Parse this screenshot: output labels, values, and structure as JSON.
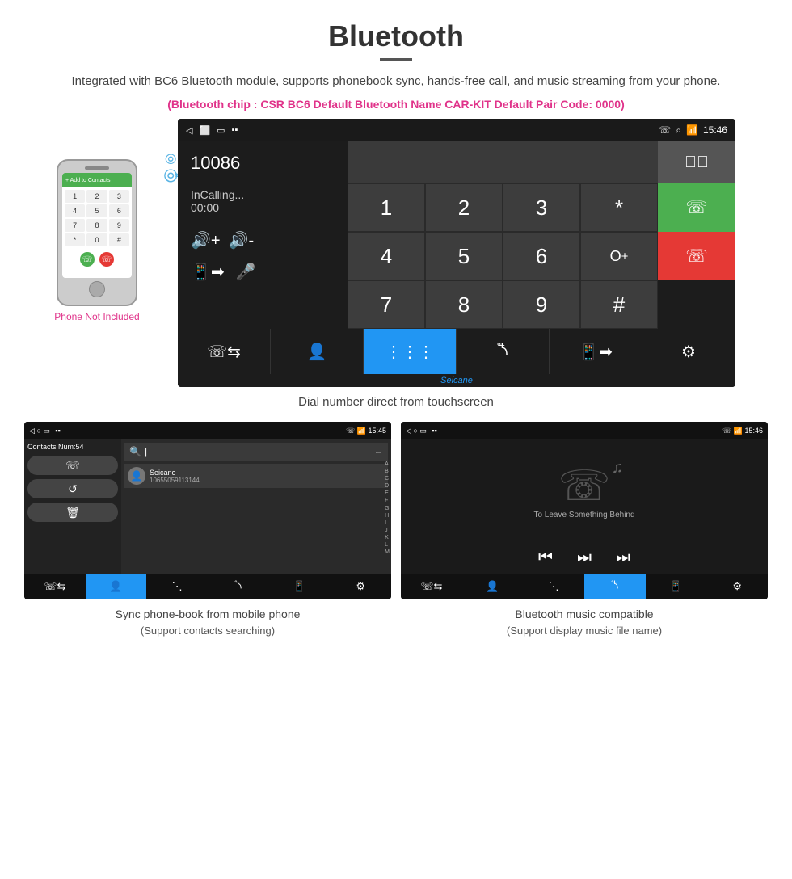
{
  "header": {
    "title": "Bluetooth",
    "description": "Integrated with BC6 Bluetooth module, supports phonebook sync, hands-free call, and music streaming from your phone.",
    "specs": "(Bluetooth chip : CSR BC6    Default Bluetooth Name CAR-KIT    Default Pair Code: 0000)"
  },
  "main_screen": {
    "status_bar": {
      "time": "15:46",
      "left_icons": [
        "back",
        "home",
        "recents",
        "signal"
      ]
    },
    "dial_number": "10086",
    "calling_status": "InCalling...",
    "timer": "00:00",
    "keypad": [
      "1",
      "2",
      "3",
      "*",
      "4",
      "5",
      "6",
      "O+",
      "7",
      "8",
      "9",
      "#"
    ],
    "bottom_nav": [
      "call-transfer",
      "contacts",
      "keypad",
      "bluetooth",
      "phone-book",
      "settings"
    ],
    "active_nav": 2,
    "watermark": "Seicane"
  },
  "caption_main": "Dial number direct from touchscreen",
  "phone_label": "Phone Not Included",
  "contacts_screen": {
    "status_time": "15:45",
    "contacts_num": "Contacts Num:54",
    "contact_name": "Seicane",
    "contact_phone": "10655059113144",
    "search_placeholder": "",
    "alpha_list": [
      "A",
      "B",
      "C",
      "D",
      "E",
      "F",
      "G",
      "H",
      "I",
      "J",
      "K",
      "L",
      "M"
    ],
    "active_nav": 1
  },
  "music_screen": {
    "status_time": "15:46",
    "song_title": "To Leave Something Behind",
    "active_nav": 3
  },
  "caption_contacts": {
    "main": "Sync phone-book from mobile phone",
    "sub": "(Support contacts searching)"
  },
  "caption_music": {
    "main": "Bluetooth music compatible",
    "sub": "(Support display music file name)"
  }
}
